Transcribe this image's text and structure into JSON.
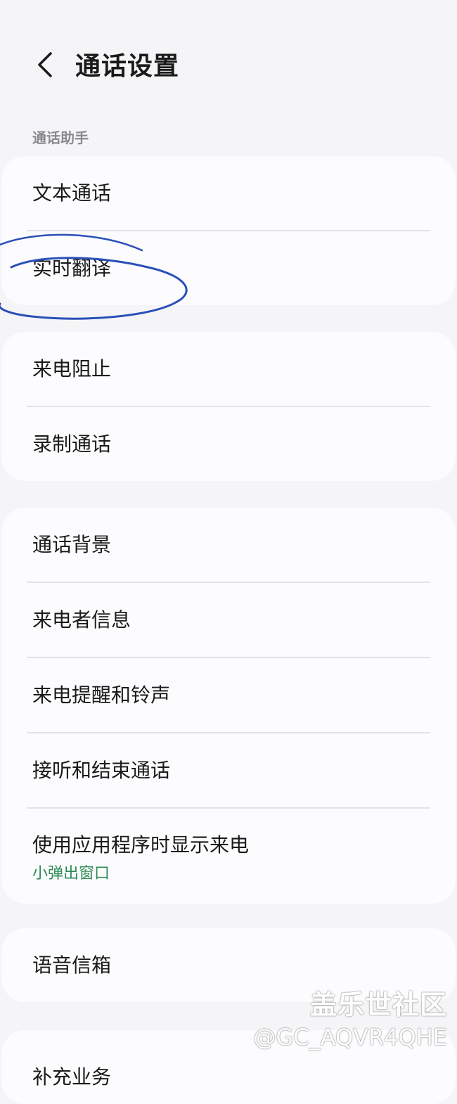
{
  "header": {
    "title": "通话设置",
    "back_icon": "chevron-left-icon"
  },
  "section": {
    "label": "通话助手"
  },
  "cards": [
    {
      "items": [
        {
          "label": "文本通话"
        },
        {
          "label": "实时翻译"
        }
      ]
    },
    {
      "items": [
        {
          "label": "来电阻止"
        },
        {
          "label": "录制通话"
        }
      ]
    },
    {
      "items": [
        {
          "label": "通话背景"
        },
        {
          "label": "来电者信息"
        },
        {
          "label": "来电提醒和铃声"
        },
        {
          "label": "接听和结束通话"
        },
        {
          "label": "使用应用程序时显示来电",
          "sub": "小弹出窗口"
        }
      ]
    },
    {
      "items": [
        {
          "label": "语音信箱"
        }
      ]
    },
    {
      "items": [
        {
          "label": "补充业务"
        }
      ]
    }
  ],
  "watermark": {
    "line1": "盖乐世社区",
    "line2": "@GC_AQVR4QHE"
  },
  "colors": {
    "background": "#f5f5f7",
    "card": "#fcfcfe",
    "subtext": "#2e8b57",
    "annotation": "#2a4fb8"
  }
}
